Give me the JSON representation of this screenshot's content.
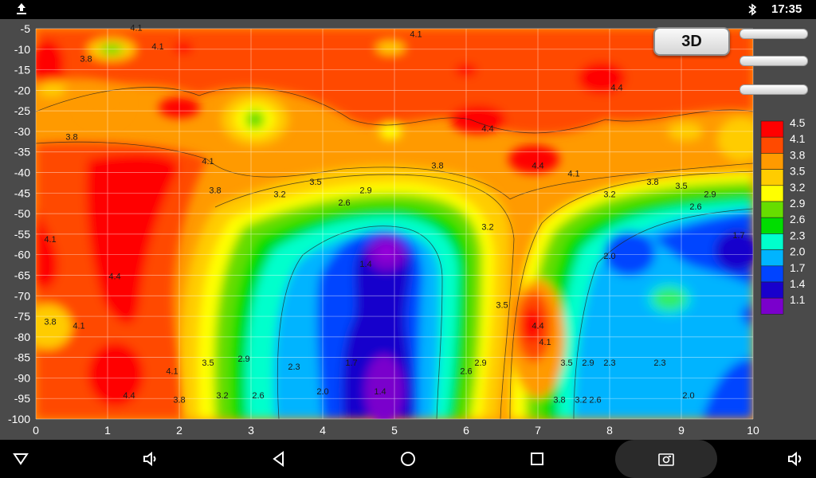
{
  "status_bar": {
    "time": "17:35",
    "upload_icon": "upload-icon",
    "bluetooth_icon": "bluetooth-icon"
  },
  "toolbar": {
    "view_3d_label": "3D",
    "menu_bars": [
      "setting-bar-1",
      "setting-bar-2",
      "setting-bar-3"
    ]
  },
  "chart_data": {
    "type": "heatmap",
    "x_ticks": [
      "0",
      "1",
      "2",
      "3",
      "4",
      "5",
      "6",
      "7",
      "8",
      "9",
      "10"
    ],
    "y_ticks": [
      "-5",
      "-10",
      "-15",
      "-20",
      "-25",
      "-30",
      "-35",
      "-40",
      "-45",
      "-50",
      "-55",
      "-60",
      "-65",
      "-70",
      "-75",
      "-80",
      "-85",
      "-90",
      "-95",
      "-100"
    ],
    "xlim": [
      0,
      10
    ],
    "ylim": [
      -100,
      -5
    ],
    "grid": true,
    "legend_levels": [
      "4.5",
      "4.1",
      "3.8",
      "3.5",
      "3.2",
      "2.9",
      "2.6",
      "2.3",
      "2.0",
      "1.7",
      "1.4",
      "1.1"
    ],
    "legend_colors": [
      "#ff0000",
      "#ff4a00",
      "#ff9a00",
      "#ffcc00",
      "#ffff00",
      "#66dd00",
      "#00dd00",
      "#00ffcc",
      "#00b4ff",
      "#0044ff",
      "#1800cc",
      "#7a00cc"
    ],
    "contour_labels": [
      {
        "x": 1.4,
        "y": -5.5,
        "text": "4.1"
      },
      {
        "x": 5.3,
        "y": -7,
        "text": "4.1"
      },
      {
        "x": 0.7,
        "y": -13,
        "text": "3.8"
      },
      {
        "x": 1.7,
        "y": -10,
        "text": "4.1"
      },
      {
        "x": 0.5,
        "y": -32,
        "text": "3.8"
      },
      {
        "x": 2.4,
        "y": -38,
        "text": "4.1"
      },
      {
        "x": 2.5,
        "y": -45,
        "text": "3.8"
      },
      {
        "x": 3.4,
        "y": -46,
        "text": "3.2"
      },
      {
        "x": 3.9,
        "y": -43,
        "text": "3.5"
      },
      {
        "x": 4.3,
        "y": -48,
        "text": "2.6"
      },
      {
        "x": 4.6,
        "y": -45,
        "text": "2.9"
      },
      {
        "x": 5.6,
        "y": -39,
        "text": "3.8"
      },
      {
        "x": 6.3,
        "y": -54,
        "text": "3.2"
      },
      {
        "x": 6.5,
        "y": -73,
        "text": "3.5"
      },
      {
        "x": 6.3,
        "y": -30,
        "text": "4.4"
      },
      {
        "x": 7.0,
        "y": -39,
        "text": "4.4"
      },
      {
        "x": 7.5,
        "y": -41,
        "text": "4.1"
      },
      {
        "x": 8.1,
        "y": -20,
        "text": "4.4"
      },
      {
        "x": 8.6,
        "y": -43,
        "text": "3.8"
      },
      {
        "x": 8.0,
        "y": -46,
        "text": "3.2"
      },
      {
        "x": 9.0,
        "y": -44,
        "text": "3.5"
      },
      {
        "x": 9.4,
        "y": -46,
        "text": "2.9"
      },
      {
        "x": 9.2,
        "y": -49,
        "text": "2.6"
      },
      {
        "x": 8.0,
        "y": -61,
        "text": "2.0"
      },
      {
        "x": 9.8,
        "y": -56,
        "text": "1.7"
      },
      {
        "x": 0.2,
        "y": -57,
        "text": "4.1"
      },
      {
        "x": 1.1,
        "y": -66,
        "text": "4.4"
      },
      {
        "x": 0.2,
        "y": -77,
        "text": "3.8"
      },
      {
        "x": 0.6,
        "y": -78,
        "text": "4.1"
      },
      {
        "x": 1.3,
        "y": -95,
        "text": "4.4"
      },
      {
        "x": 1.9,
        "y": -89,
        "text": "4.1"
      },
      {
        "x": 2.0,
        "y": -96,
        "text": "3.8"
      },
      {
        "x": 2.4,
        "y": -87,
        "text": "3.5"
      },
      {
        "x": 2.6,
        "y": -95,
        "text": "3.2"
      },
      {
        "x": 2.9,
        "y": -86,
        "text": "2.9"
      },
      {
        "x": 3.1,
        "y": -95,
        "text": "2.6"
      },
      {
        "x": 3.6,
        "y": -88,
        "text": "2.3"
      },
      {
        "x": 4.0,
        "y": -94,
        "text": "2.0"
      },
      {
        "x": 4.4,
        "y": -87,
        "text": "1.7"
      },
      {
        "x": 4.6,
        "y": -63,
        "text": "1.4"
      },
      {
        "x": 4.8,
        "y": -94,
        "text": "1.4"
      },
      {
        "x": 6.0,
        "y": -89,
        "text": "2.6"
      },
      {
        "x": 6.2,
        "y": -87,
        "text": "2.9"
      },
      {
        "x": 7.1,
        "y": -82,
        "text": "4.1"
      },
      {
        "x": 7.0,
        "y": -78,
        "text": "4.4"
      },
      {
        "x": 7.3,
        "y": -96,
        "text": "3.8"
      },
      {
        "x": 7.4,
        "y": -87,
        "text": "3.5"
      },
      {
        "x": 7.6,
        "y": -96,
        "text": "3.2"
      },
      {
        "x": 7.7,
        "y": -87,
        "text": "2.9"
      },
      {
        "x": 7.8,
        "y": -96,
        "text": "2.6"
      },
      {
        "x": 8.0,
        "y": -87,
        "text": "2.3"
      },
      {
        "x": 8.7,
        "y": -87,
        "text": "2.3"
      },
      {
        "x": 9.1,
        "y": -95,
        "text": "2.0"
      }
    ]
  }
}
